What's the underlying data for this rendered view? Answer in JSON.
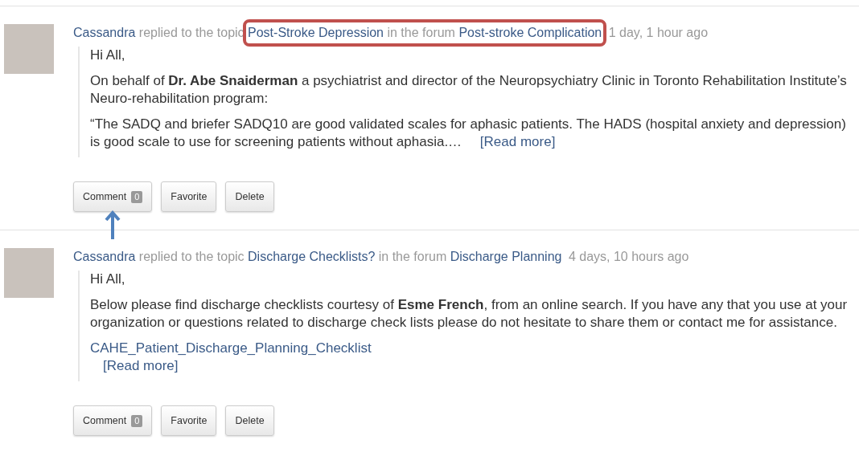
{
  "activities": [
    {
      "author": "Cassandra",
      "action": "replied to the topic",
      "topic": "Post-Stroke Depression",
      "forum_prefix": "in the forum",
      "forum": "Post-stroke Complication",
      "time": "1 day, 1 hour ago",
      "highlighted": true,
      "paragraphs": [
        {
          "kind": "text",
          "text": "Hi All,"
        },
        {
          "kind": "text",
          "text": "On behalf of **Dr. Abe Snaiderman** a psychiatrist and director of the Neuropsychiatry Clinic in Toronto Rehabilitation Institute’s Neuro-rehabilitation program:"
        },
        {
          "kind": "excerpt",
          "text": "“The SADQ and briefer SADQ10 are good validated scales for aphasic patients. The HADS (hospital anxiety and depression) is good scale to use for screening patients without aphasia.…",
          "read_more": "[Read more]"
        }
      ],
      "buttons": [
        {
          "kind": "count",
          "label": "Comment",
          "count": "0",
          "pointed": true
        },
        {
          "kind": "plain",
          "label": "Favorite",
          "pointed": false
        },
        {
          "kind": "plain",
          "label": "Delete",
          "pointed": false
        }
      ]
    },
    {
      "author": "Cassandra",
      "action": "replied to the topic",
      "topic": "Discharge Checklists?",
      "forum_prefix": "in the forum",
      "forum": "Discharge Planning",
      "time": "4 days, 10 hours ago",
      "highlighted": false,
      "paragraphs": [
        {
          "kind": "text",
          "text": "Hi All,"
        },
        {
          "kind": "text",
          "text": "Below please find discharge checklists courtesy of **Esme French**, from an online search. If you have any that you use at your organization or questions related to discharge check lists please do not hesitate to share them or contact me for assistance."
        },
        {
          "kind": "attachment",
          "link": "CAHE_Patient_Discharge_Planning_Checklist",
          "read_more": "[Read more]"
        }
      ],
      "buttons": [
        {
          "kind": "count",
          "label": "Comment",
          "count": "0",
          "pointed": false
        },
        {
          "kind": "plain",
          "label": "Favorite",
          "pointed": false
        },
        {
          "kind": "plain",
          "label": "Delete",
          "pointed": false
        }
      ]
    }
  ]
}
